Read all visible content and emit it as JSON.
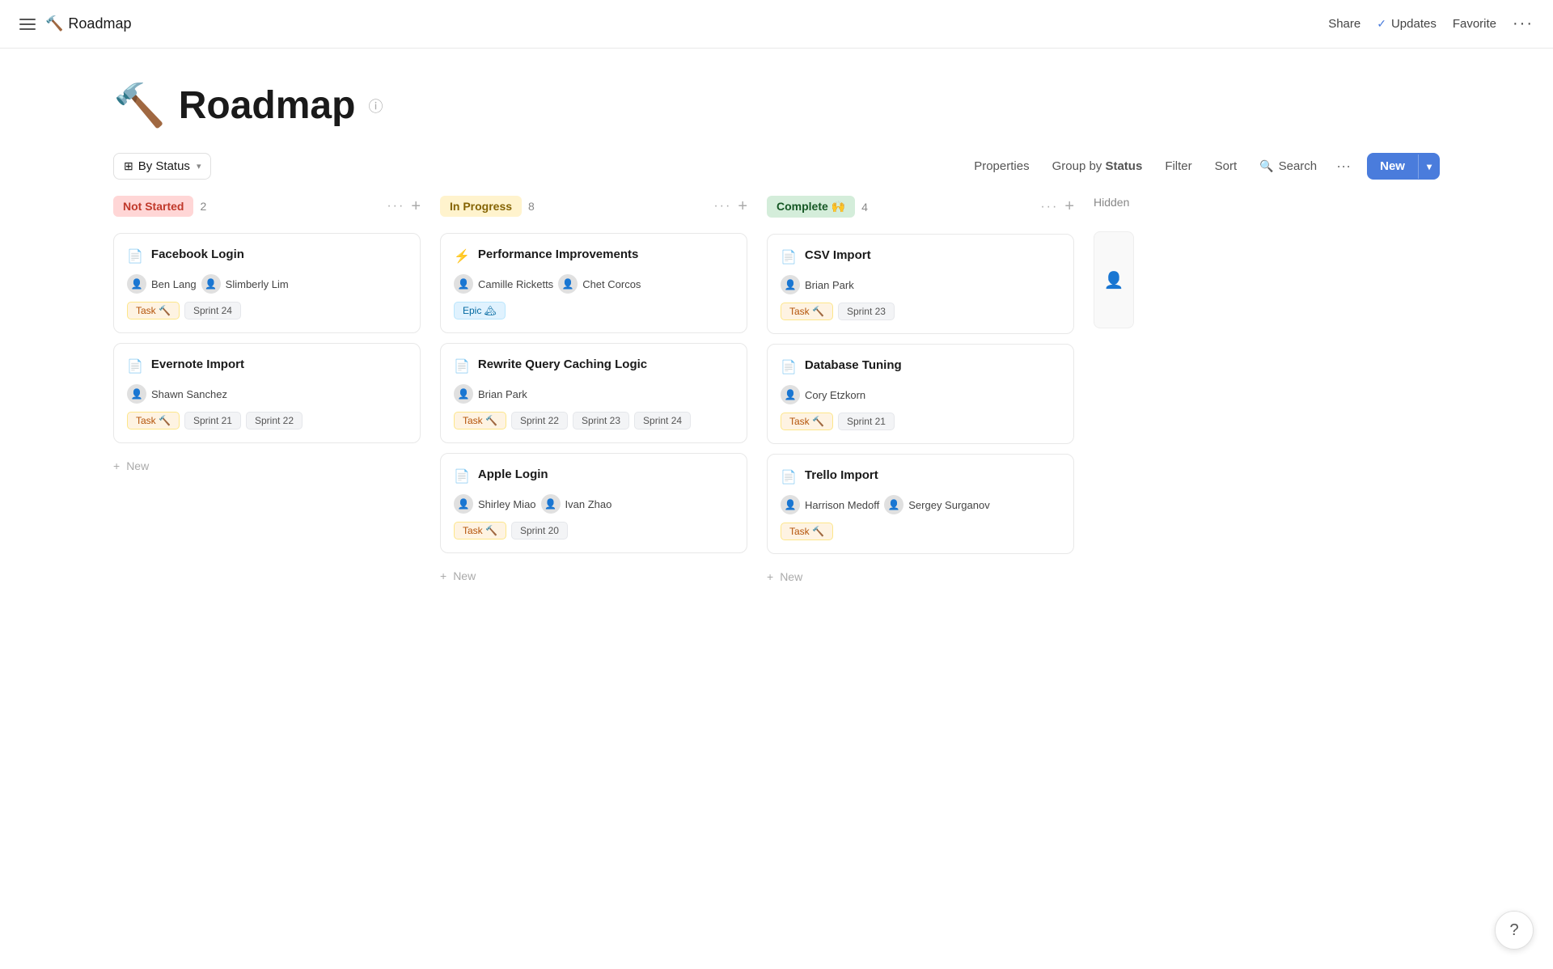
{
  "nav": {
    "title": "Roadmap",
    "title_icon": "🔨",
    "share_label": "Share",
    "updates_label": "Updates",
    "favorite_label": "Favorite"
  },
  "page": {
    "title": "Roadmap",
    "title_icon": "🔨",
    "info_tooltip": "Info"
  },
  "toolbar": {
    "view_label": "By Status",
    "properties_label": "Properties",
    "group_by_label": "Group by",
    "group_by_value": "Status",
    "filter_label": "Filter",
    "sort_label": "Sort",
    "search_label": "Search",
    "more_label": "···",
    "new_label": "New"
  },
  "columns": [
    {
      "id": "not-started",
      "status": "Not Started",
      "status_class": "not-started",
      "count": "2",
      "cards": [
        {
          "title": "Facebook Login",
          "icon": "📄",
          "assignees": [
            {
              "name": "Ben Lang",
              "emoji": "👤"
            },
            {
              "name": "Slimberly Lim",
              "emoji": "👤"
            }
          ],
          "tags": [
            {
              "label": "Task 🔨",
              "type": "task"
            },
            {
              "label": "Sprint 24",
              "type": "sprint"
            }
          ]
        },
        {
          "title": "Evernote Import",
          "icon": "📄",
          "assignees": [
            {
              "name": "Shawn Sanchez",
              "emoji": "👤"
            }
          ],
          "tags": [
            {
              "label": "Task 🔨",
              "type": "task"
            },
            {
              "label": "Sprint 21",
              "type": "sprint"
            },
            {
              "label": "Sprint 22",
              "type": "sprint"
            }
          ]
        }
      ],
      "add_label": "New"
    },
    {
      "id": "in-progress",
      "status": "In Progress",
      "status_class": "in-progress",
      "count": "8",
      "cards": [
        {
          "title": "Performance Improvements",
          "icon": "⚡",
          "assignees": [
            {
              "name": "Camille Ricketts",
              "emoji": "👤"
            },
            {
              "name": "Chet Corcos",
              "emoji": "👤"
            }
          ],
          "tags": [
            {
              "label": "Epic 🏔",
              "type": "epic"
            }
          ]
        },
        {
          "title": "Rewrite Query Caching Logic",
          "icon": "📄",
          "assignees": [
            {
              "name": "Brian Park",
              "emoji": "👤"
            }
          ],
          "tags": [
            {
              "label": "Task 🔨",
              "type": "task"
            },
            {
              "label": "Sprint 22",
              "type": "sprint"
            },
            {
              "label": "Sprint 23",
              "type": "sprint"
            },
            {
              "label": "Sprint 24",
              "type": "sprint"
            }
          ]
        },
        {
          "title": "Apple Login",
          "icon": "📄",
          "assignees": [
            {
              "name": "Shirley Miao",
              "emoji": "👤"
            },
            {
              "name": "Ivan Zhao",
              "emoji": "👤"
            }
          ],
          "tags": [
            {
              "label": "Task 🔨",
              "type": "task"
            },
            {
              "label": "Sprint 20",
              "type": "sprint"
            }
          ]
        }
      ],
      "add_label": "New"
    },
    {
      "id": "complete",
      "status": "Complete 🙌",
      "status_class": "complete",
      "count": "4",
      "cards": [
        {
          "title": "CSV Import",
          "icon": "📄",
          "assignees": [
            {
              "name": "Brian Park",
              "emoji": "👤"
            }
          ],
          "tags": [
            {
              "label": "Task 🔨",
              "type": "task"
            },
            {
              "label": "Sprint 23",
              "type": "sprint"
            }
          ]
        },
        {
          "title": "Database Tuning",
          "icon": "📄",
          "assignees": [
            {
              "name": "Cory Etzkorn",
              "emoji": "👤"
            }
          ],
          "tags": [
            {
              "label": "Task 🔨",
              "type": "task"
            },
            {
              "label": "Sprint 21",
              "type": "sprint"
            }
          ]
        },
        {
          "title": "Trello Import",
          "icon": "📄",
          "assignees": [
            {
              "name": "Harrison Medoff",
              "emoji": "👤"
            },
            {
              "name": "Sergey Surganov",
              "emoji": "👤"
            }
          ],
          "tags": [
            {
              "label": "Task 🔨",
              "type": "task"
            }
          ]
        }
      ],
      "add_label": "New"
    }
  ],
  "hidden": {
    "label": "Hidden"
  },
  "help": {
    "label": "?"
  }
}
